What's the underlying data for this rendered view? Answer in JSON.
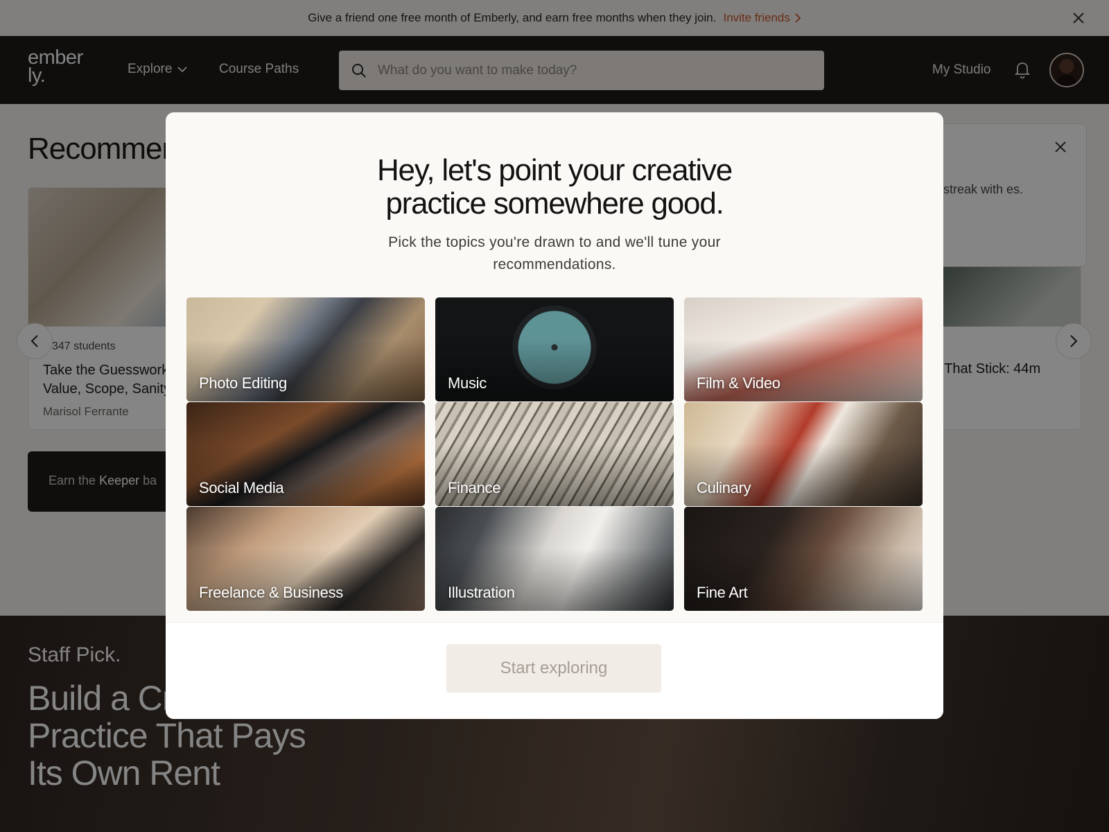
{
  "promo": {
    "text": "Give a friend one free month of Emberly, and earn free months when they join.",
    "link": "Invite friends"
  },
  "header": {
    "logo_line1": "ember",
    "logo_line2": "ly.",
    "explore": "Explore",
    "course_paths": "Course Paths",
    "search_placeholder": "What do you want to make today?",
    "my_studio": "My Studio"
  },
  "page": {
    "rec_title": "Recommen",
    "card_left": {
      "students": "347 students",
      "title": "Take the Guesswork Value, Scope, Sanity",
      "author": "Marisol Ferrante"
    },
    "keeper_prefix": "Earn the",
    "keeper_bold": "Keeper",
    "keeper_suffix": "ba",
    "card_right_title": "s That Stick: 44m",
    "toast_text": "streak with es.",
    "staff_label": "Staff Pick.",
    "staff_title": "Build a Creative Practice That Pays Its Own Rent"
  },
  "modal": {
    "title_line1": "Hey, let's point your creative",
    "title_line2": "practice somewhere good.",
    "subtitle": "Pick the topics you're drawn to and we'll tune your recommendations.",
    "topics": [
      {
        "label": "Photo Editing"
      },
      {
        "label": "Music"
      },
      {
        "label": "Film & Video"
      },
      {
        "label": "Social Media"
      },
      {
        "label": "Finance"
      },
      {
        "label": "Culinary"
      },
      {
        "label": "Freelance & Business"
      },
      {
        "label": "Illustration"
      },
      {
        "label": "Fine Art"
      }
    ],
    "start_button": "Start exploring"
  },
  "colors": {
    "accent": "#c8532a",
    "header_bg": "#1f1b19",
    "modal_bg": "#fbf9f6"
  }
}
